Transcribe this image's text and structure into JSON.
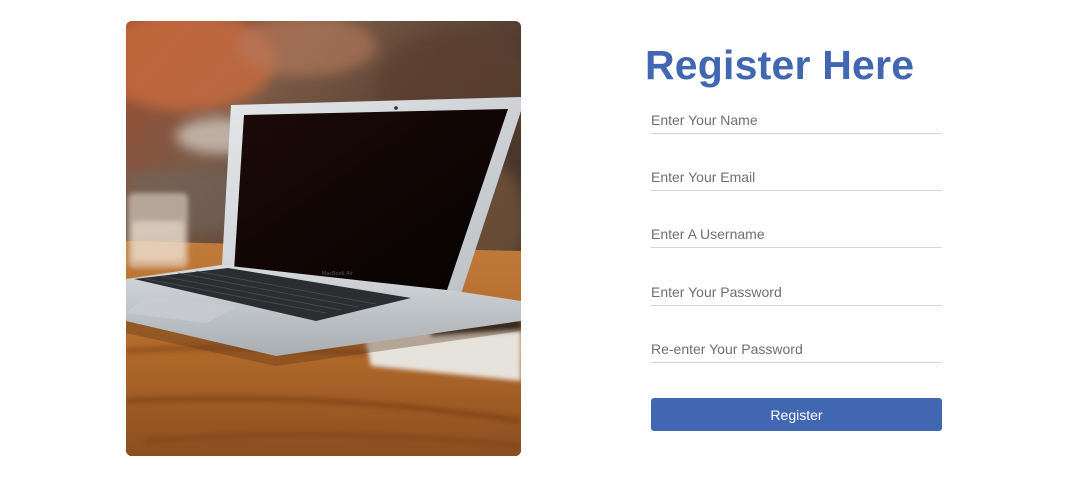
{
  "form": {
    "title": "Register Here",
    "fields": [
      {
        "placeholder": "Enter Your Name",
        "value": ""
      },
      {
        "placeholder": "Enter Your Email",
        "value": ""
      },
      {
        "placeholder": "Enter A Username",
        "value": ""
      },
      {
        "placeholder": "Enter Your Password",
        "value": ""
      },
      {
        "placeholder": "Re-enter Your Password",
        "value": ""
      }
    ],
    "submit_label": "Register"
  },
  "photo": {
    "subject": "laptop-on-wooden-table",
    "laptop_brand_text": "MacBook Air"
  },
  "colors": {
    "accent": "#4267b2",
    "button_text": "#ffffff",
    "field_underline": "#d6d6d6",
    "placeholder": "#6f6f6f"
  }
}
